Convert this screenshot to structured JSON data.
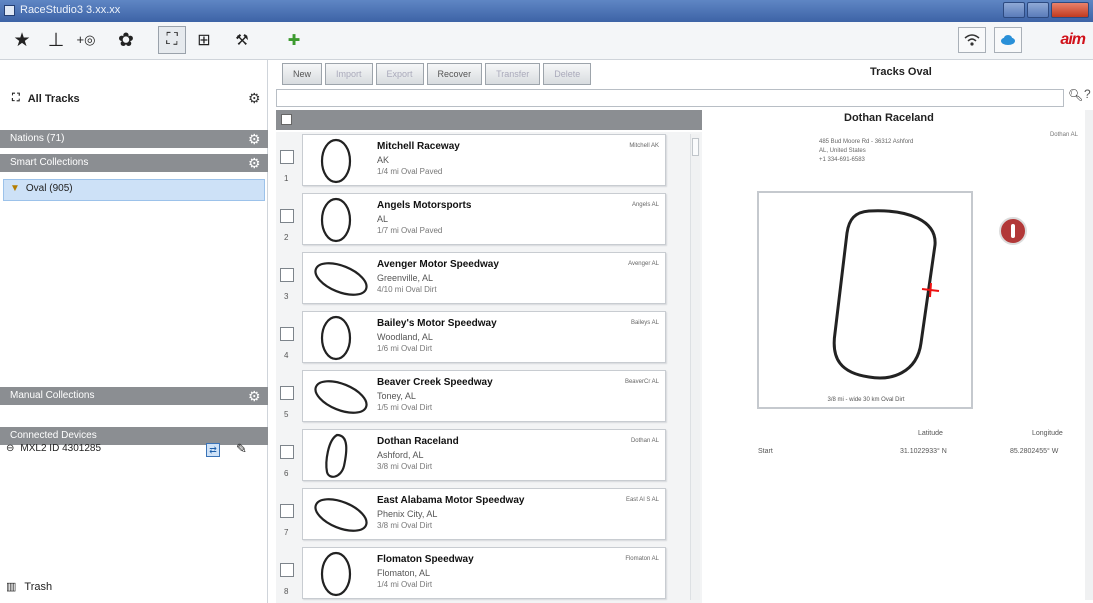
{
  "window": {
    "title": "RaceStudio3 3.xx.xx"
  },
  "toolbar": {
    "icons": [
      "star-icon",
      "anchor-icon",
      "add-icon",
      "gear-icon",
      "track-icon",
      "grid-icon",
      "car-icon",
      "plug-icon"
    ],
    "right_icons": [
      "wifi-icon",
      "cloud-icon"
    ],
    "brand": "aim"
  },
  "left": {
    "all_tracks": "All Tracks",
    "nations": "Nations (71)",
    "smart_collections": "Smart Collections",
    "selected_collection": "Oval (905)",
    "manual_collections": "Manual Collections",
    "connected_devices": "Connected Devices",
    "device_name": "MXL2 ID 4301285",
    "trash": "Trash"
  },
  "mid": {
    "buttons": [
      "New",
      "Import",
      "Export",
      "Recover",
      "Transfer",
      "Delete"
    ]
  },
  "tracks": [
    {
      "num": "1",
      "name": "Mitchell Raceway",
      "loc": "AK",
      "len": "1/4 mi Oval Paved",
      "short": "Mitchell AK",
      "shape": "oval-v"
    },
    {
      "num": "2",
      "name": "Angels Motorsports",
      "loc": "AL",
      "len": "1/7 mi Oval Paved",
      "short": "Angels AL",
      "shape": "oval-v"
    },
    {
      "num": "3",
      "name": "Avenger Motor Speedway",
      "loc": "Greenville, AL",
      "len": "4/10 mi Oval Dirt",
      "short": "Avenger AL",
      "shape": "oval-d"
    },
    {
      "num": "4",
      "name": "Bailey's Motor Speedway",
      "loc": "Woodland, AL",
      "len": "1/6 mi Oval Dirt",
      "short": "Baileys AL",
      "shape": "oval-v"
    },
    {
      "num": "5",
      "name": "Beaver Creek Speedway",
      "loc": "Toney, AL",
      "len": "1/5 mi Oval Dirt",
      "short": "BeaverCr AL",
      "shape": "oval-d"
    },
    {
      "num": "6",
      "name": "Dothan Raceland",
      "loc": "Ashford, AL",
      "len": "3/8 mi Oval Dirt",
      "short": "Dothan AL",
      "shape": "oval-n"
    },
    {
      "num": "7",
      "name": "East Alabama Motor Speedway",
      "loc": "Phenix City, AL",
      "len": "3/8 mi Oval Dirt",
      "short": "East Al S AL",
      "shape": "oval-d"
    },
    {
      "num": "8",
      "name": "Flomaton Speedway",
      "loc": "Flomaton, AL",
      "len": "1/4 mi Oval Dirt",
      "short": "Flomaton AL",
      "shape": "oval-v"
    }
  ],
  "detail": {
    "panel_title": "Tracks Oval",
    "name": "Dothan Raceland",
    "short": "Dothan AL",
    "address1": "485 Bud Moore Rd - 36312 Ashford",
    "address2": "AL, United States",
    "phone": "+1 334-691-6583",
    "map_caption": "3/8 mi - wide 30 km Oval Dirt",
    "lat_header": "Latitude",
    "lon_header": "Longitude",
    "start_label": "Start",
    "lat": "31.1022933° N",
    "lon": "85.2802455° W"
  }
}
